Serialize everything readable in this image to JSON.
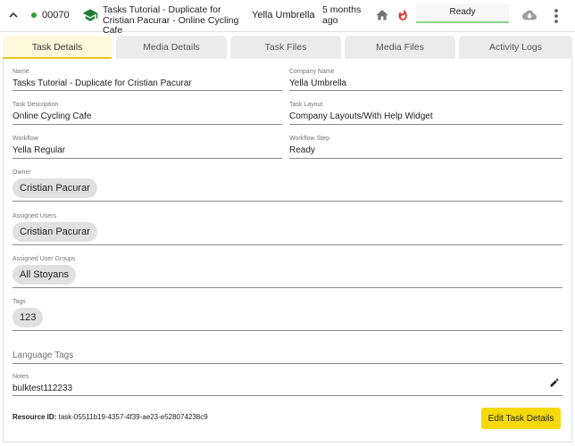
{
  "header": {
    "task_id": "00070",
    "task_title": "Tasks Tutorial - Duplicate for Cristian Pacurar - Online Cycling Cafe",
    "company": "Yella Umbrella",
    "time_ago": "5 months ago",
    "status": "Ready"
  },
  "tabs": [
    {
      "label": "Task Details",
      "active": true
    },
    {
      "label": "Media Details"
    },
    {
      "label": "Task Files"
    },
    {
      "label": "Media Files"
    },
    {
      "label": "Activity Logs"
    }
  ],
  "form": {
    "name": {
      "label": "Name",
      "value": "Tasks Tutorial - Duplicate for Cristian Pacurar"
    },
    "company_name": {
      "label": "Company Name",
      "value": "Yella Umbrella"
    },
    "task_description": {
      "label": "Task Description",
      "value": "Online Cycling Cafe"
    },
    "task_layout": {
      "label": "Task Layout",
      "value": "Company Layouts/With Help Widget"
    },
    "workflow": {
      "label": "Workflow",
      "value": "Yella Regular"
    },
    "workflow_step": {
      "label": "Workflow Step",
      "value": "Ready"
    },
    "owner": {
      "label": "Owner",
      "chip": "Cristian Pacurar"
    },
    "assigned_users": {
      "label": "Assigned Users",
      "chip": "Cristian Pacurar"
    },
    "assigned_user_groups": {
      "label": "Assigned User Groups",
      "chip": "All Stoyans"
    },
    "tags": {
      "label": "Tags",
      "chip": "123"
    },
    "language_tags": {
      "placeholder": "Language Tags"
    },
    "notes": {
      "label": "Notes",
      "value": "bulktest112233"
    }
  },
  "footer": {
    "resource_label": "Resource ID:",
    "resource_id": "task-05511b19-4357-4f39-ae23-e528074238c9",
    "edit_button": "Edit Task Details"
  },
  "colors": {
    "accent": "#f5d90a",
    "active_tab_bg": "#fff8dc",
    "status_dot": "#2e9d3a",
    "status_underline": "#8bd48e",
    "fire": "#e53935",
    "cap": "#1e7d32"
  }
}
